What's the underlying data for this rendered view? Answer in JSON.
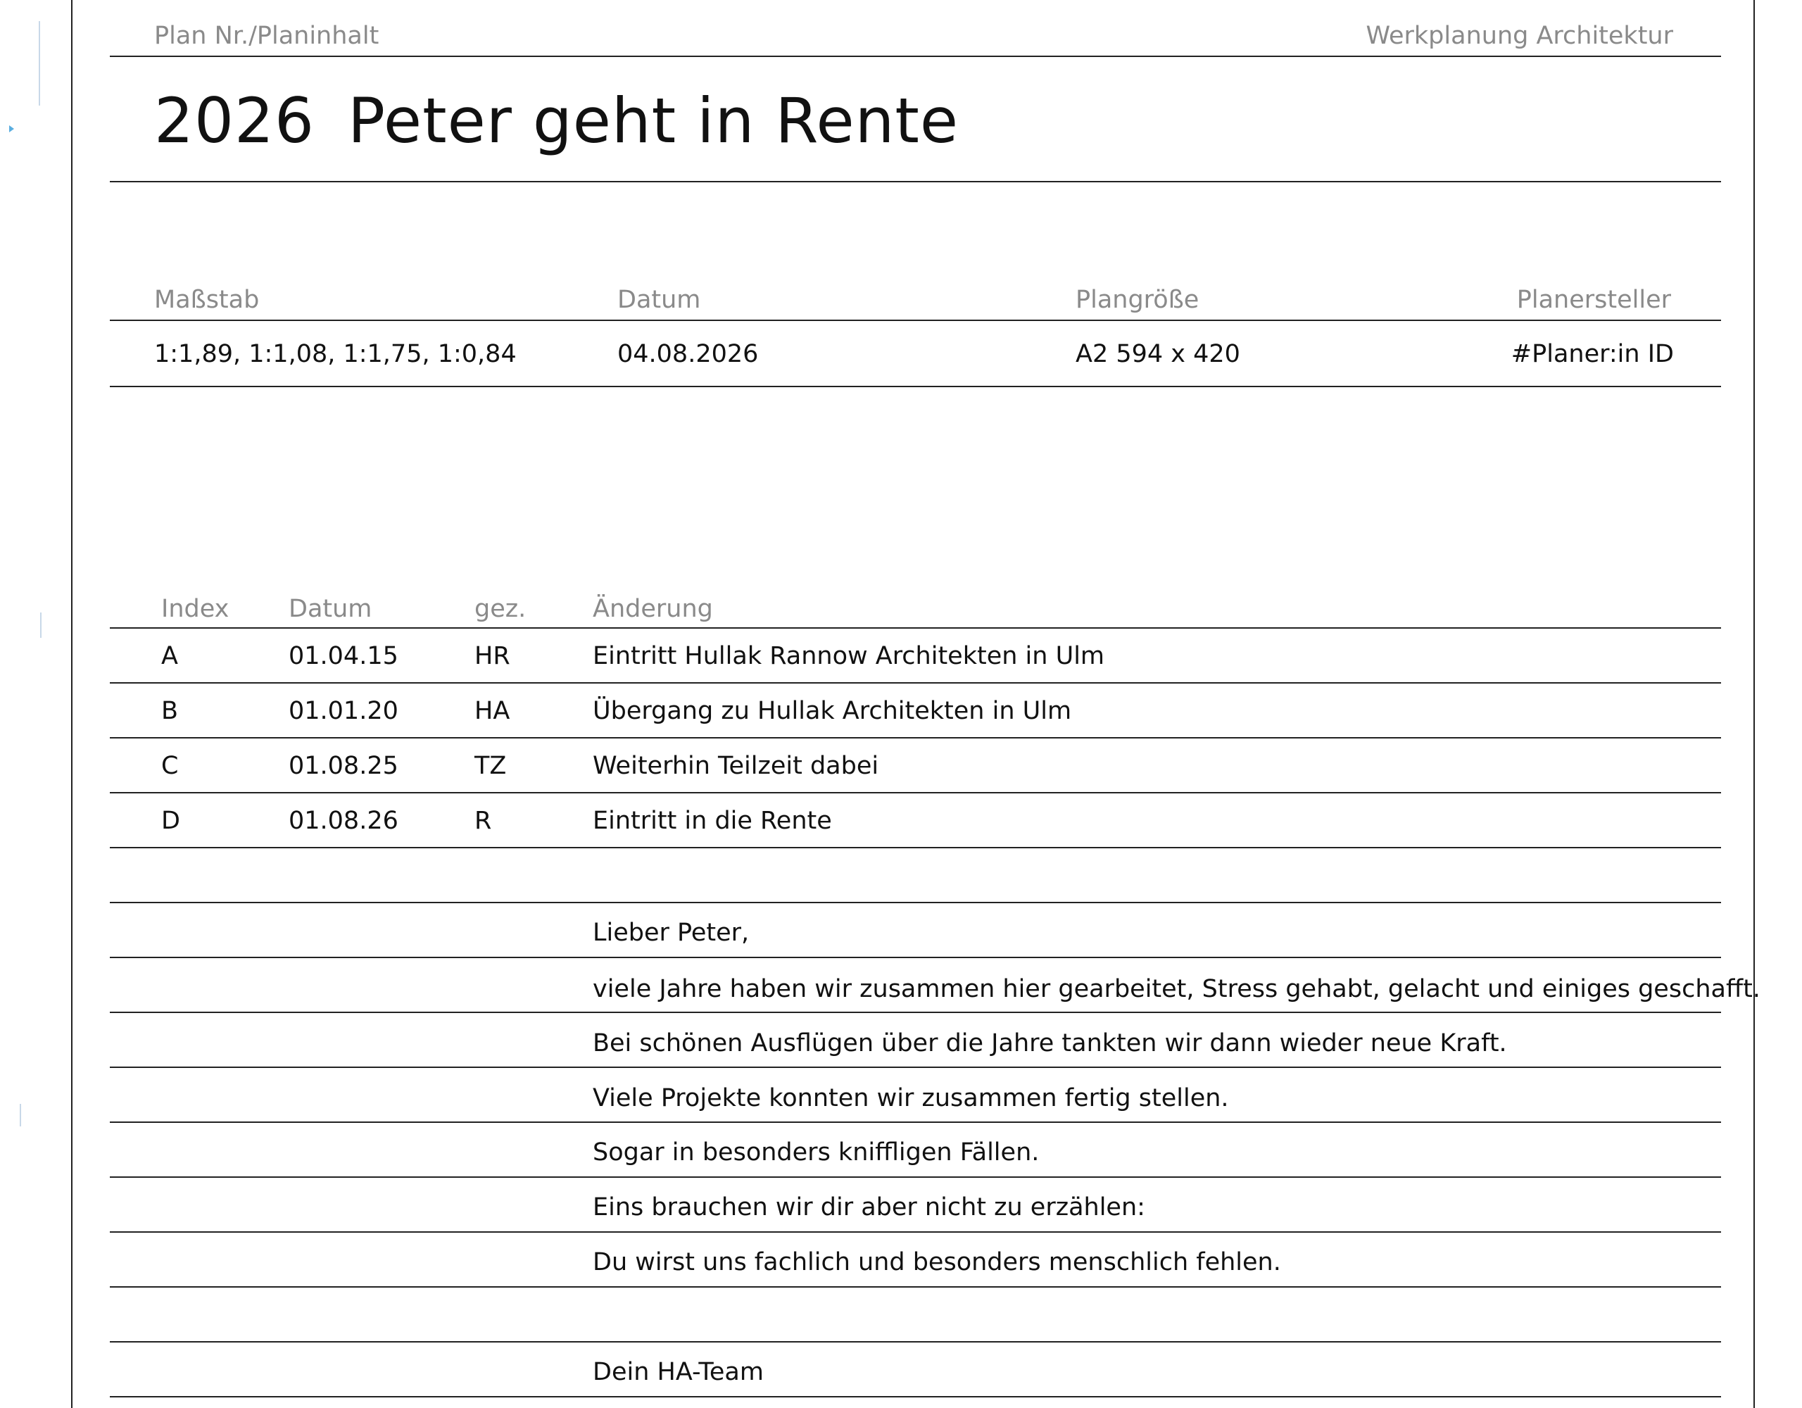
{
  "header": {
    "plan_label": "Plan Nr./Planinhalt",
    "category": "Werkplanung Architektur",
    "year": "2026",
    "title": "Peter geht in Rente"
  },
  "meta": {
    "labels": [
      "Maßstab",
      "Datum",
      "Plangröße",
      "Planersteller"
    ],
    "values": [
      "1:1,89, 1:1,08, 1:1,75, 1:0,84",
      "04.08.2026",
      "A2 594 x 420",
      "#Planer:in ID"
    ]
  },
  "revisions": {
    "headers": [
      "Index",
      "Datum",
      "gez.",
      "Änderung"
    ],
    "rows": [
      {
        "index": "A",
        "date": "01.04.15",
        "drawn": "HR",
        "change": "Eintritt Hullak Rannow Architekten in Ulm"
      },
      {
        "index": "B",
        "date": "01.01.20",
        "drawn": "HA",
        "change": "Übergang zu Hullak Architekten in Ulm"
      },
      {
        "index": "C",
        "date": "01.08.25",
        "drawn": "TZ",
        "change": "Weiterhin Teilzeit dabei"
      },
      {
        "index": "D",
        "date": "01.08.26",
        "drawn": "R",
        "change": "Eintritt in die Rente"
      }
    ]
  },
  "message": {
    "lines": [
      "",
      "Lieber Peter,",
      "viele Jahre haben wir zusammen hier gearbeitet, Stress gehabt, gelacht und einiges geschafft.",
      "Bei schönen Ausflügen über die Jahre tankten wir dann wieder neue Kraft.",
      "Viele Projekte konnten wir zusammen fertig stellen.",
      "Sogar in besonders kniffligen Fällen.",
      "Eins brauchen wir dir aber nicht zu erzählen:",
      "Du wirst uns fachlich und besonders menschlich fehlen.",
      "",
      "Dein HA-Team"
    ]
  }
}
